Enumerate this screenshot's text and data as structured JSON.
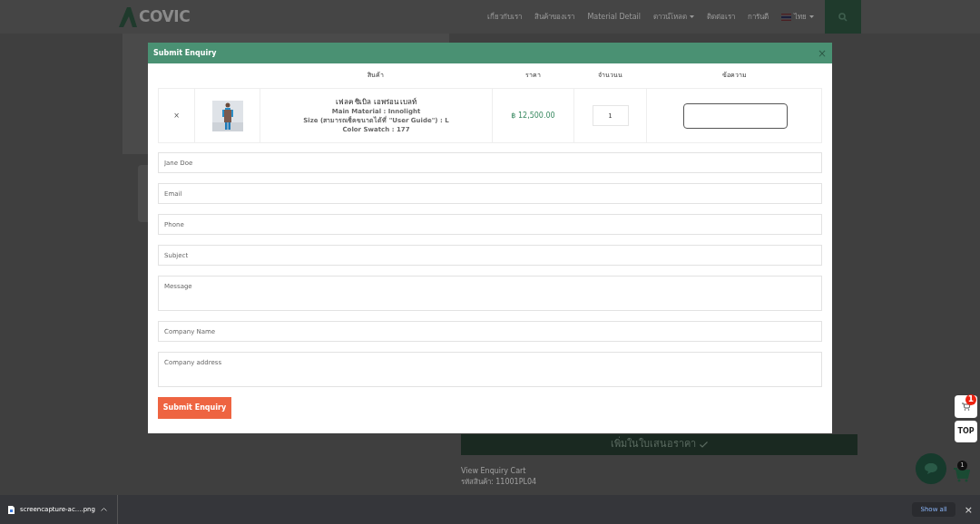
{
  "site": {
    "logo": "COVIC",
    "nav": [
      {
        "label": "เกี่ยวกับเรา",
        "dropdown": false
      },
      {
        "label": "สินค้าของเรา",
        "dropdown": false
      },
      {
        "label": "Material Detail",
        "dropdown": false
      },
      {
        "label": "ดาวน์โหลด",
        "dropdown": true
      },
      {
        "label": "ติดต่อเรา",
        "dropdown": false
      },
      {
        "label": "การันตี",
        "dropdown": false
      },
      {
        "label": "ไทย",
        "dropdown": true,
        "kind": "language"
      }
    ],
    "add_button": "เพิ่มในใบเสนอราคา",
    "cart_link": "View Enquiry Cart",
    "sku": "รหัสสินค้า: 11001PL04"
  },
  "modal": {
    "title": "Submit Enquiry",
    "close": "×",
    "columns": [
      "",
      "",
      "สินค้า",
      "ราคา",
      "จำนวนน",
      "ข้อความ"
    ],
    "items": [
      {
        "remove": "×",
        "name": "เฟลค ซิเบิล เอพร่อน เบลท์",
        "details": [
          "Main Material : Innolight",
          "Size (สามารถเช็คขนาดได้ที่ \"User Guide\") : L",
          "Color Swatch : 177"
        ],
        "price": "฿ 12,500.00",
        "quantity": "1"
      }
    ],
    "fields": [
      {
        "placeholder": "Jane Doe",
        "kind": "input"
      },
      {
        "placeholder": "Email",
        "kind": "input"
      },
      {
        "placeholder": "Phone",
        "kind": "input"
      },
      {
        "placeholder": "Subject",
        "kind": "input"
      },
      {
        "placeholder": "Message",
        "kind": "textarea"
      },
      {
        "placeholder": "Company Name",
        "kind": "input"
      },
      {
        "placeholder": "Company address",
        "kind": "textarea"
      }
    ],
    "submit": "Submit Enquiry"
  },
  "floating": {
    "cart_count": "1",
    "top": "TOP",
    "chat_cart_count": "1"
  },
  "download_bar": {
    "file": "screencapture-ac....png",
    "show_all": "Show all",
    "close": "×"
  }
}
